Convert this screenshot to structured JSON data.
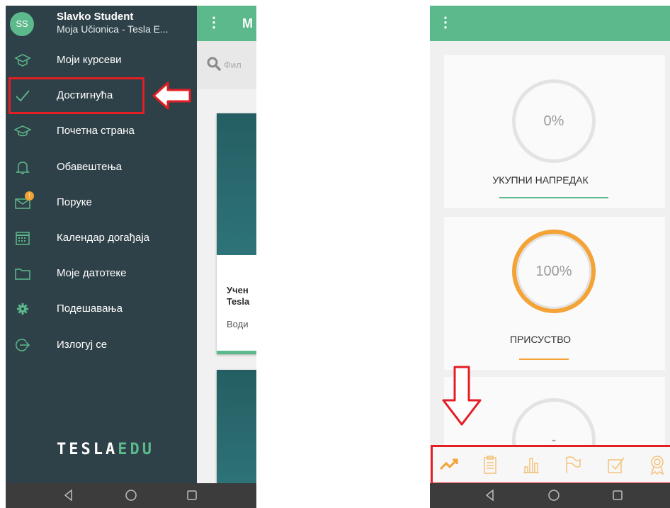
{
  "left_screen": {
    "user": {
      "initials": "SS",
      "name": "Slavko Student",
      "subtitle": "Moja Učionica - Tesla E..."
    },
    "menu": [
      {
        "label": "Моји курсеви",
        "icon": "courses-icon"
      },
      {
        "label": "Достигнућа",
        "icon": "checkmark-icon"
      },
      {
        "label": "Почетна страна",
        "icon": "graduation-cap-icon"
      },
      {
        "label": "Обавештења",
        "icon": "bell-icon"
      },
      {
        "label": "Поруке",
        "icon": "envelope-icon",
        "badge": "!"
      },
      {
        "label": "Календар догађаја",
        "icon": "calendar-icon"
      },
      {
        "label": "Моје датотеке",
        "icon": "folder-icon"
      },
      {
        "label": "Подешавања",
        "icon": "gear-icon"
      },
      {
        "label": "Излогуј се",
        "icon": "logout-icon"
      }
    ],
    "logo": {
      "main": "TESLA",
      "accent": "EDU"
    },
    "behind": {
      "toolbar_title": "M",
      "filter_placeholder": "Фил",
      "card_title_1": "Учен",
      "card_title_2": "Tesla",
      "card_subtitle": "Води"
    }
  },
  "right_screen": {
    "stats": [
      {
        "value": "0%",
        "label": "УКУПНИ НАПРЕДАК",
        "color": "#5bb98b"
      },
      {
        "value": "100%",
        "label": "ПРИСУСТВО",
        "color": "#f4a337"
      },
      {
        "value": "-",
        "label": ""
      }
    ],
    "tabs": [
      "progress-icon",
      "clipboard-icon",
      "bar-chart-icon",
      "flag-icon",
      "checkbox-icon",
      "award-icon"
    ]
  },
  "colors": {
    "accent_green": "#5bb98b",
    "drawer_bg": "#2f4148",
    "highlight_red": "#e31e24",
    "orange": "#f4a337"
  }
}
